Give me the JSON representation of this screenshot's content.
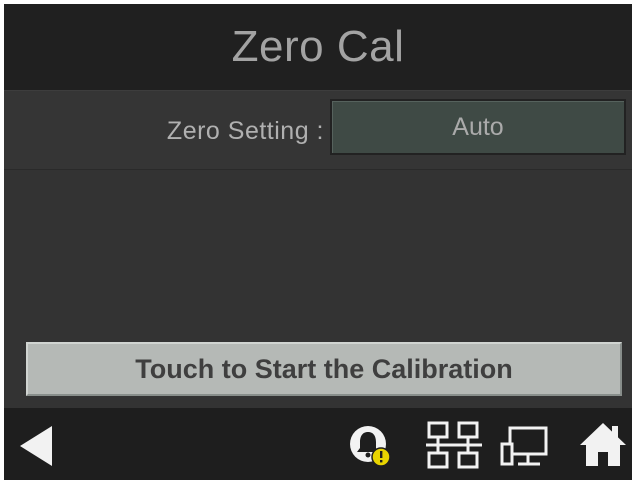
{
  "header": {
    "title": "Zero Cal"
  },
  "zero_setting": {
    "label": "Zero Setting :",
    "value": "Auto"
  },
  "start_button": {
    "label": "Touch to Start the Calibration"
  },
  "footer": {
    "icons": [
      "back-icon",
      "alarm-icon",
      "network-icon",
      "display-icon",
      "home-icon"
    ]
  },
  "colors": {
    "screen_bg": "#333333",
    "header_bg": "#202020",
    "footer_bg": "#1e1e1e",
    "value_box_bg": "#3f4a45",
    "button_bg": "#b5b9b6",
    "alarm_badge": "#e8d400"
  }
}
